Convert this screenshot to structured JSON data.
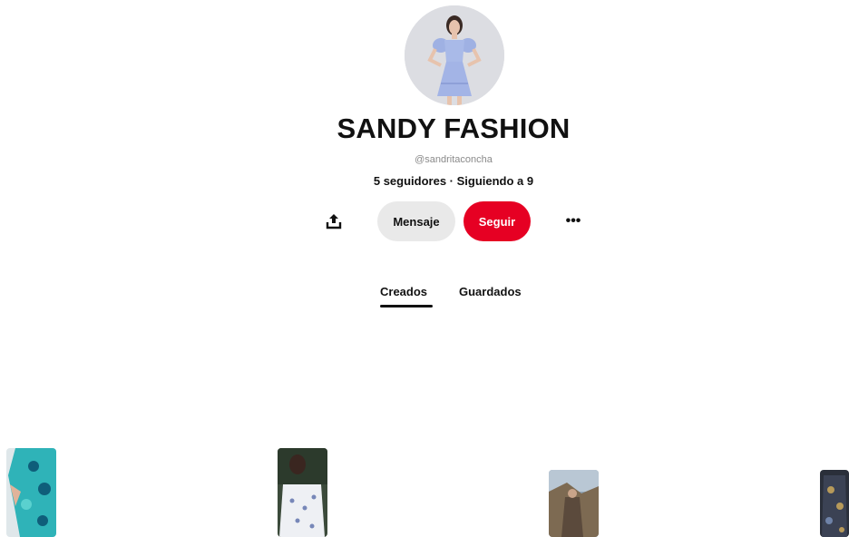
{
  "profile": {
    "name": "SANDY FASHION",
    "handle": "@sandritaconcha",
    "stats": "5 seguidores · Siguiendo a 9",
    "avatar_icon": "profile-photo-woman-blue-dress"
  },
  "actions": {
    "share_icon": "share-upload-icon",
    "message_label": "Mensaje",
    "follow_label": "Seguir",
    "more_icon": "more-options-icon",
    "more_glyph": "•••"
  },
  "tabs": [
    {
      "label": "Creados",
      "active": true
    },
    {
      "label": "Guardados",
      "active": false
    }
  ],
  "pins": [
    {
      "icon": "pin-teal-floral-shirt"
    },
    {
      "icon": "pin-white-printed-shirt"
    },
    {
      "icon": "pin-outdoor-photo"
    },
    {
      "icon": "pin-dark-patterned-garment"
    }
  ],
  "colors": {
    "follow_button": "#e60023",
    "message_button": "#e9e9e9",
    "text": "#111111",
    "handle_text": "#8a8a8a"
  }
}
